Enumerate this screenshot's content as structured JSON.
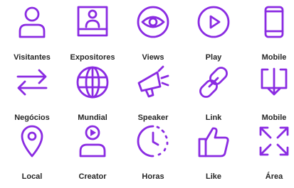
{
  "accent_color": "#8a2be2",
  "label_color": "#262626",
  "icons": [
    {
      "label": "Visitantes",
      "icon": "user-icon"
    },
    {
      "label": "Expositores",
      "icon": "exhibitor-board-icon"
    },
    {
      "label": "Views",
      "icon": "eye-icon"
    },
    {
      "label": "Play",
      "icon": "play-icon"
    },
    {
      "label": "Mobile",
      "icon": "mobile-phone-icon"
    },
    {
      "label": "Negócios",
      "icon": "exchange-arrows-icon"
    },
    {
      "label": "Mundial",
      "icon": "globe-icon"
    },
    {
      "label": "Speaker",
      "icon": "megaphone-icon"
    },
    {
      "label": "Link",
      "icon": "link-icon"
    },
    {
      "label": "Mobile",
      "icon": "download-tray-icon"
    },
    {
      "label": "Local",
      "icon": "location-pin-icon"
    },
    {
      "label": "Creator",
      "icon": "creator-user-play-icon"
    },
    {
      "label": "Horas",
      "icon": "clock-icon"
    },
    {
      "label": "Like",
      "icon": "thumbs-up-icon"
    },
    {
      "label": "Área",
      "icon": "expand-arrows-icon"
    }
  ]
}
